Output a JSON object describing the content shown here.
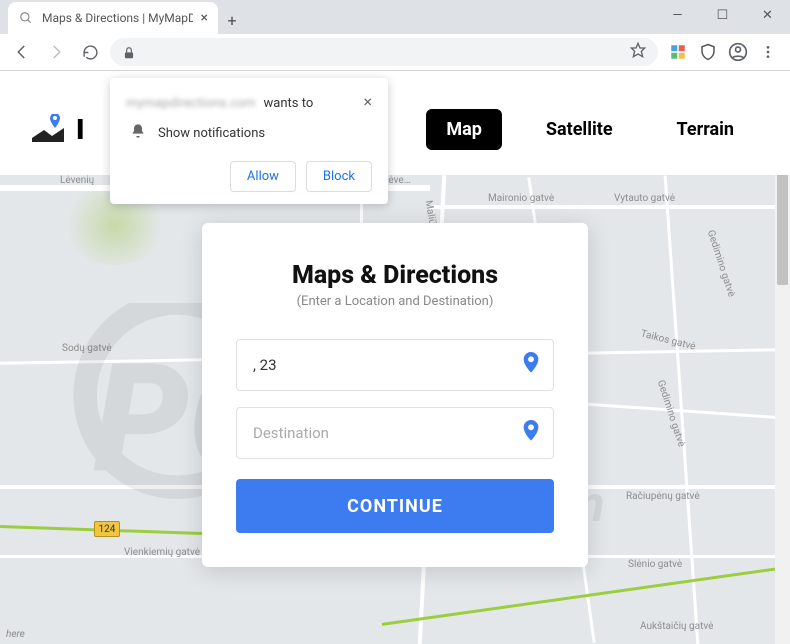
{
  "window": {
    "tab_title": "Maps & Directions | MyMapDirec",
    "controls": {
      "min": "—",
      "max": "☐",
      "close": "✕"
    }
  },
  "toolbar": {
    "newtab": "+"
  },
  "notification": {
    "domain": "mymapdirections.com",
    "wants": "wants to",
    "line": "Show notifications",
    "allow": "Allow",
    "block": "Block"
  },
  "page": {
    "logo_initial": "I",
    "tabs": {
      "map": "Map",
      "satellite": "Satellite",
      "terrain": "Terrain"
    }
  },
  "card": {
    "title": "Maps & Directions",
    "subtitle": "(Enter a Location and Destination)",
    "location_value": ", 23",
    "destination_placeholder": "Destination",
    "continue": "CONTINUE"
  },
  "map": {
    "roads": {
      "leveniu": "Lėvenių",
      "leve": "Lėve…",
      "maliunu": "Maliūnų gatvė",
      "maironio": "Maironio gatvė",
      "vytauto": "Vytauto gatvė",
      "gedimino": "Gedimino gatvė",
      "sodu": "Sodų gatvė",
      "taikos": "Taikos gatvė",
      "raciupenu": "Račiupėnų gatvė",
      "vienkiemiu": "Vienkiemių gatvė",
      "slenio": "Slėnio gatvė",
      "aukstaiciu": "Aukštaičių gatvė",
      "gedimino2": "Gedimino gatvė"
    },
    "marker": "124",
    "attribution": "here"
  }
}
